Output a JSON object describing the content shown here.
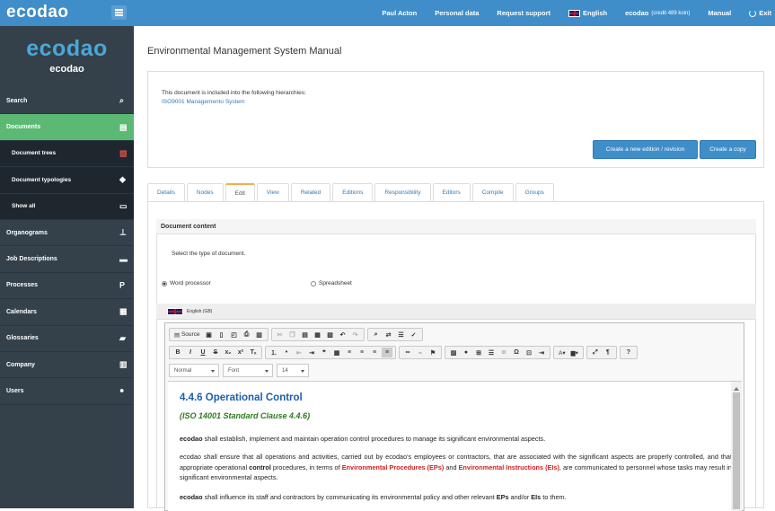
{
  "topbar": {
    "brand": "ecodao",
    "user": "Paul Acton",
    "personal": "Personal data",
    "support": "Request support",
    "language": "English",
    "account": "ecodao",
    "credit": "(credit 489 koin)",
    "manual": "Manual",
    "exit": "Exit"
  },
  "sidebar": {
    "logo_big": "ecodao",
    "logo_small": "ecodao",
    "items": [
      {
        "label": "Search",
        "icon": "search-icon"
      },
      {
        "label": "Documents",
        "icon": "document-icon",
        "active": true
      },
      {
        "label": "Document trees",
        "icon": "pdf-icon",
        "sub": true
      },
      {
        "label": "Document typologies",
        "icon": "tags-icon",
        "sub": true
      },
      {
        "label": "Show all",
        "icon": "list-icon",
        "sub": true
      },
      {
        "label": "Organograms",
        "icon": "sitemap-icon"
      },
      {
        "label": "Job Descriptions",
        "icon": "briefcase-icon"
      },
      {
        "label": "Processes",
        "icon": "process-icon"
      },
      {
        "label": "Calendars",
        "icon": "calendar-icon"
      },
      {
        "label": "Glossaries",
        "icon": "book-icon"
      },
      {
        "label": "Company",
        "icon": "building-icon"
      },
      {
        "label": "Users",
        "icon": "user-icon"
      }
    ]
  },
  "main": {
    "title": "Environmental Management System Manual",
    "hierarchy_label": "This document is included into the following hierarchies:",
    "hierarchy_link": "ISO9001 Managemento System",
    "new_edition_button": "Create a new edition / revision",
    "copy_button": "Create a copy",
    "tabs": [
      "Details",
      "Nodes",
      "Edit",
      "View",
      "Related",
      "Editions",
      "Responsibility",
      "Editors",
      "Compile",
      "Groups"
    ],
    "active_tab": "Edit",
    "panel_title": "Document content",
    "select_type": "Select the type of document.",
    "radio_word": "Word processor",
    "radio_sheet": "Spreadsheet",
    "lang_label": "English (GB)"
  },
  "editor": {
    "source_label": "Source",
    "format_dd": "Normal",
    "font_dd": "Font",
    "size_dd": "14",
    "heading": "4.4.6 Operational Control",
    "subheading": "(ISO 14001 Standard Clause 4.4.6)",
    "p1_bold": "ecodao",
    "p1_rest": " shall establish, implement and maintain operation control procedures to manage its significant environmental aspects.",
    "p2_a": "ecodao shall ensure that all operations and activities, carried out by ecodao's employees or contractors, that are associated with the significant aspects are properly controlled, and that appropriate operational ",
    "p2_b": "control",
    "p2_c": " procedures, in terms of ",
    "p2_red1": "Environmental Procedures (EPs)",
    "p2_d": " and ",
    "p2_red2": "Environmental Instructions (EIs)",
    "p2_e": ", are communicated to personnel whose tasks may result in significant environmental aspects.",
    "p3_bold": "ecodao",
    "p3_a": " shall influence its staff and contractors by communicating its environmental policy and other relevant ",
    "p3_b": "EPs",
    "p3_c": " and/or ",
    "p3_d": "EIs",
    "p3_e": " to them."
  },
  "colors": {
    "topbar": "#3f8ec9",
    "sidebar": "#34414b",
    "active": "#5cb974",
    "heading": "#1f5fa8",
    "subheading": "#2d7a1f",
    "emphasis": "#d02020"
  }
}
